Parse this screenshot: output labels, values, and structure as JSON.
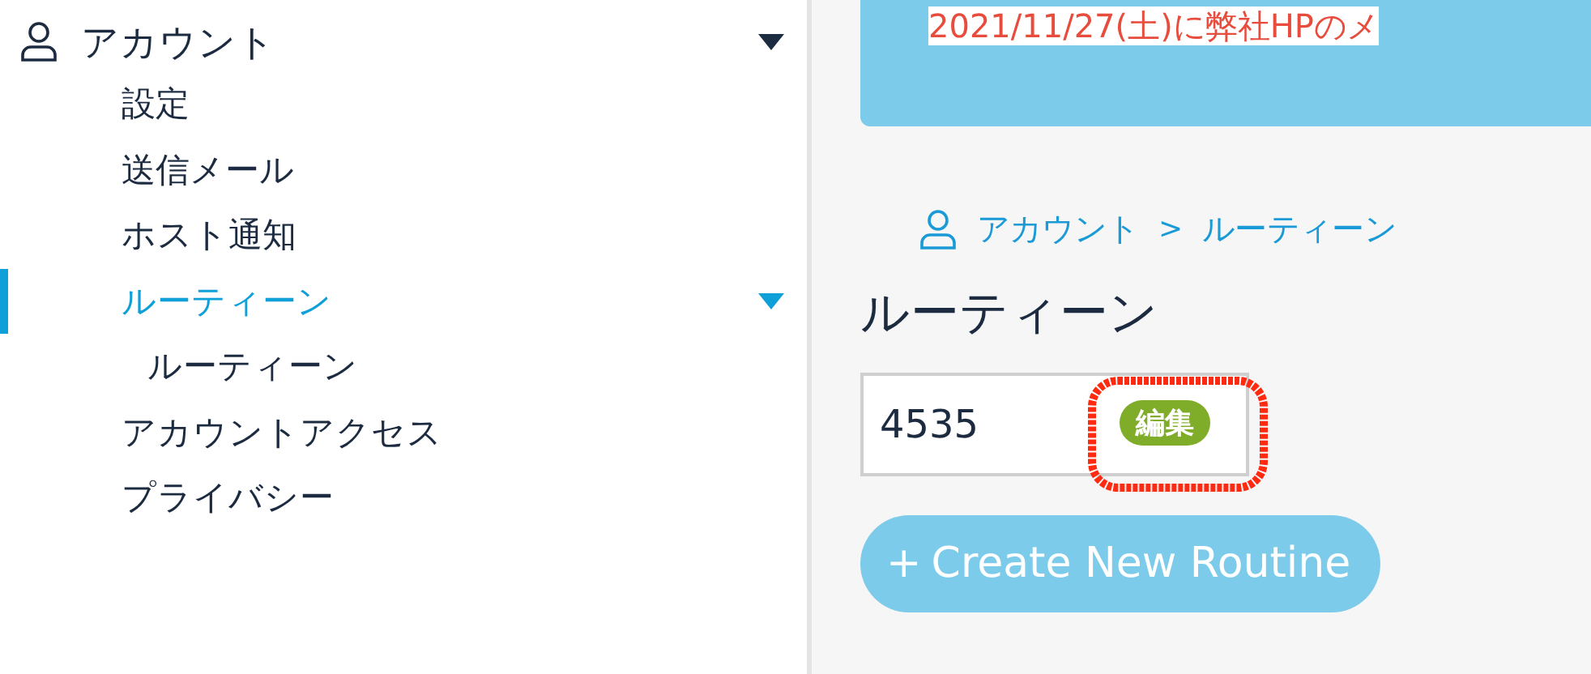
{
  "sidebar": {
    "group": {
      "label": "アカウント",
      "expanded": true,
      "items": [
        {
          "label": "設定",
          "selected": false
        },
        {
          "label": "送信メール",
          "selected": false
        },
        {
          "label": "ホスト通知",
          "selected": false
        },
        {
          "label": "ルーティーン",
          "selected": true,
          "expanded": true,
          "children": [
            {
              "label": "ルーティーン",
              "selected": false
            }
          ]
        },
        {
          "label": "アカウントアクセス",
          "selected": false
        },
        {
          "label": "プライバシー",
          "selected": false
        }
      ]
    }
  },
  "banner": {
    "text": "2021/11/27(土)に弊社HPのメ"
  },
  "breadcrumb": [
    "アカウント",
    "ルーティーン"
  ],
  "breadcrumb_separator": ">",
  "title": "ルーティーン",
  "routines": [
    {
      "value": "4535",
      "action": "編集"
    }
  ],
  "create_button": {
    "label": "Create New Routine",
    "icon": "+"
  }
}
